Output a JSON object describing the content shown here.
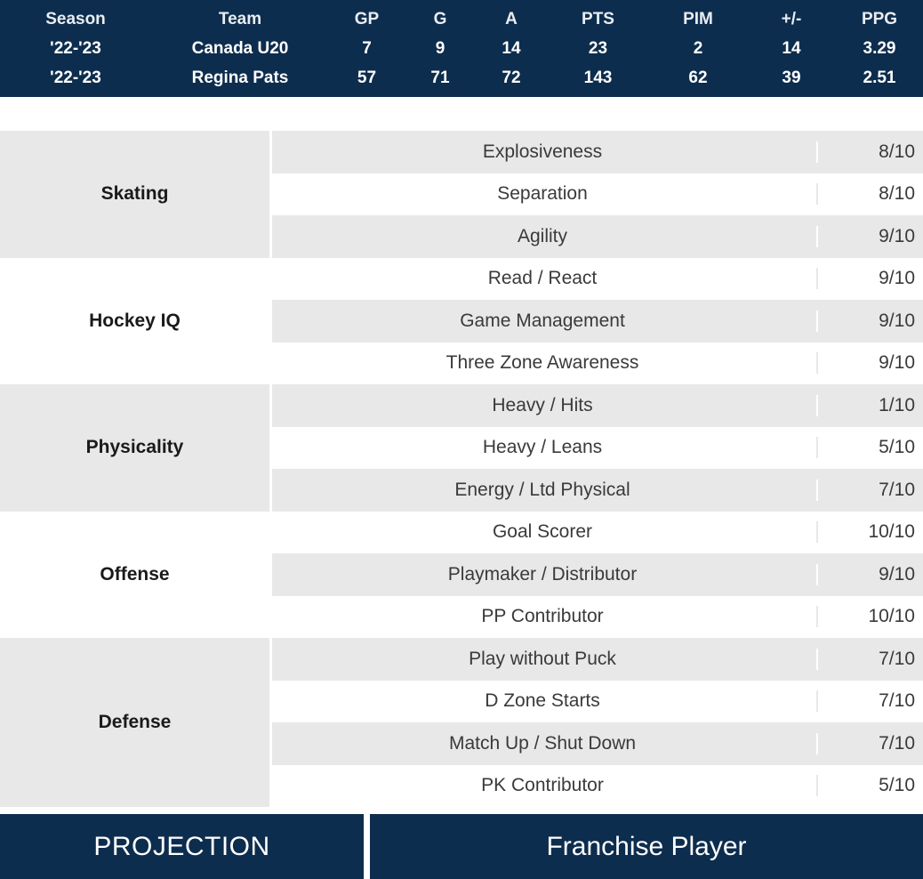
{
  "stats_table": {
    "headers": {
      "season": "Season",
      "team": "Team",
      "gp": "GP",
      "g": "G",
      "a": "A",
      "pts": "PTS",
      "pim": "PIM",
      "plus_minus": "+/-",
      "ppg": "PPG"
    },
    "rows": [
      {
        "season": "'22-'23",
        "team": "Canada U20",
        "gp": "7",
        "g": "9",
        "a": "14",
        "pts": "23",
        "pim": "2",
        "plus_minus": "14",
        "ppg": "3.29"
      },
      {
        "season": "'22-'23",
        "team": "Regina Pats",
        "gp": "57",
        "g": "71",
        "a": "72",
        "pts": "143",
        "pim": "62",
        "plus_minus": "39",
        "ppg": "2.51"
      }
    ]
  },
  "attributes": {
    "groups": [
      {
        "category": "Skating",
        "category_shade": "gray",
        "rows": [
          {
            "name": "Explosiveness",
            "score": "8/10",
            "shade": "gray"
          },
          {
            "name": "Separation",
            "score": "8/10",
            "shade": "white"
          },
          {
            "name": "Agility",
            "score": "9/10",
            "shade": "gray"
          }
        ]
      },
      {
        "category": "Hockey IQ",
        "category_shade": "white",
        "rows": [
          {
            "name": "Read / React",
            "score": "9/10",
            "shade": "white"
          },
          {
            "name": "Game Management",
            "score": "9/10",
            "shade": "gray"
          },
          {
            "name": "Three Zone Awareness",
            "score": "9/10",
            "shade": "white"
          }
        ]
      },
      {
        "category": "Physicality",
        "category_shade": "gray",
        "rows": [
          {
            "name": "Heavy / Hits",
            "score": "1/10",
            "shade": "gray"
          },
          {
            "name": "Heavy / Leans",
            "score": "5/10",
            "shade": "white"
          },
          {
            "name": "Energy / Ltd Physical",
            "score": "7/10",
            "shade": "gray"
          }
        ]
      },
      {
        "category": "Offense",
        "category_shade": "white",
        "rows": [
          {
            "name": "Goal Scorer",
            "score": "10/10",
            "shade": "white"
          },
          {
            "name": "Playmaker / Distributor",
            "score": "9/10",
            "shade": "gray"
          },
          {
            "name": "PP Contributor",
            "score": "10/10",
            "shade": "white"
          }
        ]
      },
      {
        "category": "Defense",
        "category_shade": "gray",
        "rows": [
          {
            "name": "Play without Puck",
            "score": "7/10",
            "shade": "gray"
          },
          {
            "name": "D Zone Starts",
            "score": "7/10",
            "shade": "white"
          },
          {
            "name": "Match Up / Shut Down",
            "score": "7/10",
            "shade": "gray"
          },
          {
            "name": "PK Contributor",
            "score": "5/10",
            "shade": "white"
          }
        ]
      }
    ]
  },
  "projection": {
    "label": "PROJECTION",
    "value": "Franchise Player"
  },
  "colors": {
    "navy": "#0d2d4e",
    "row_gray": "#e8e8e8",
    "row_white": "#ffffff",
    "text_dark": "#3a3a3a"
  }
}
